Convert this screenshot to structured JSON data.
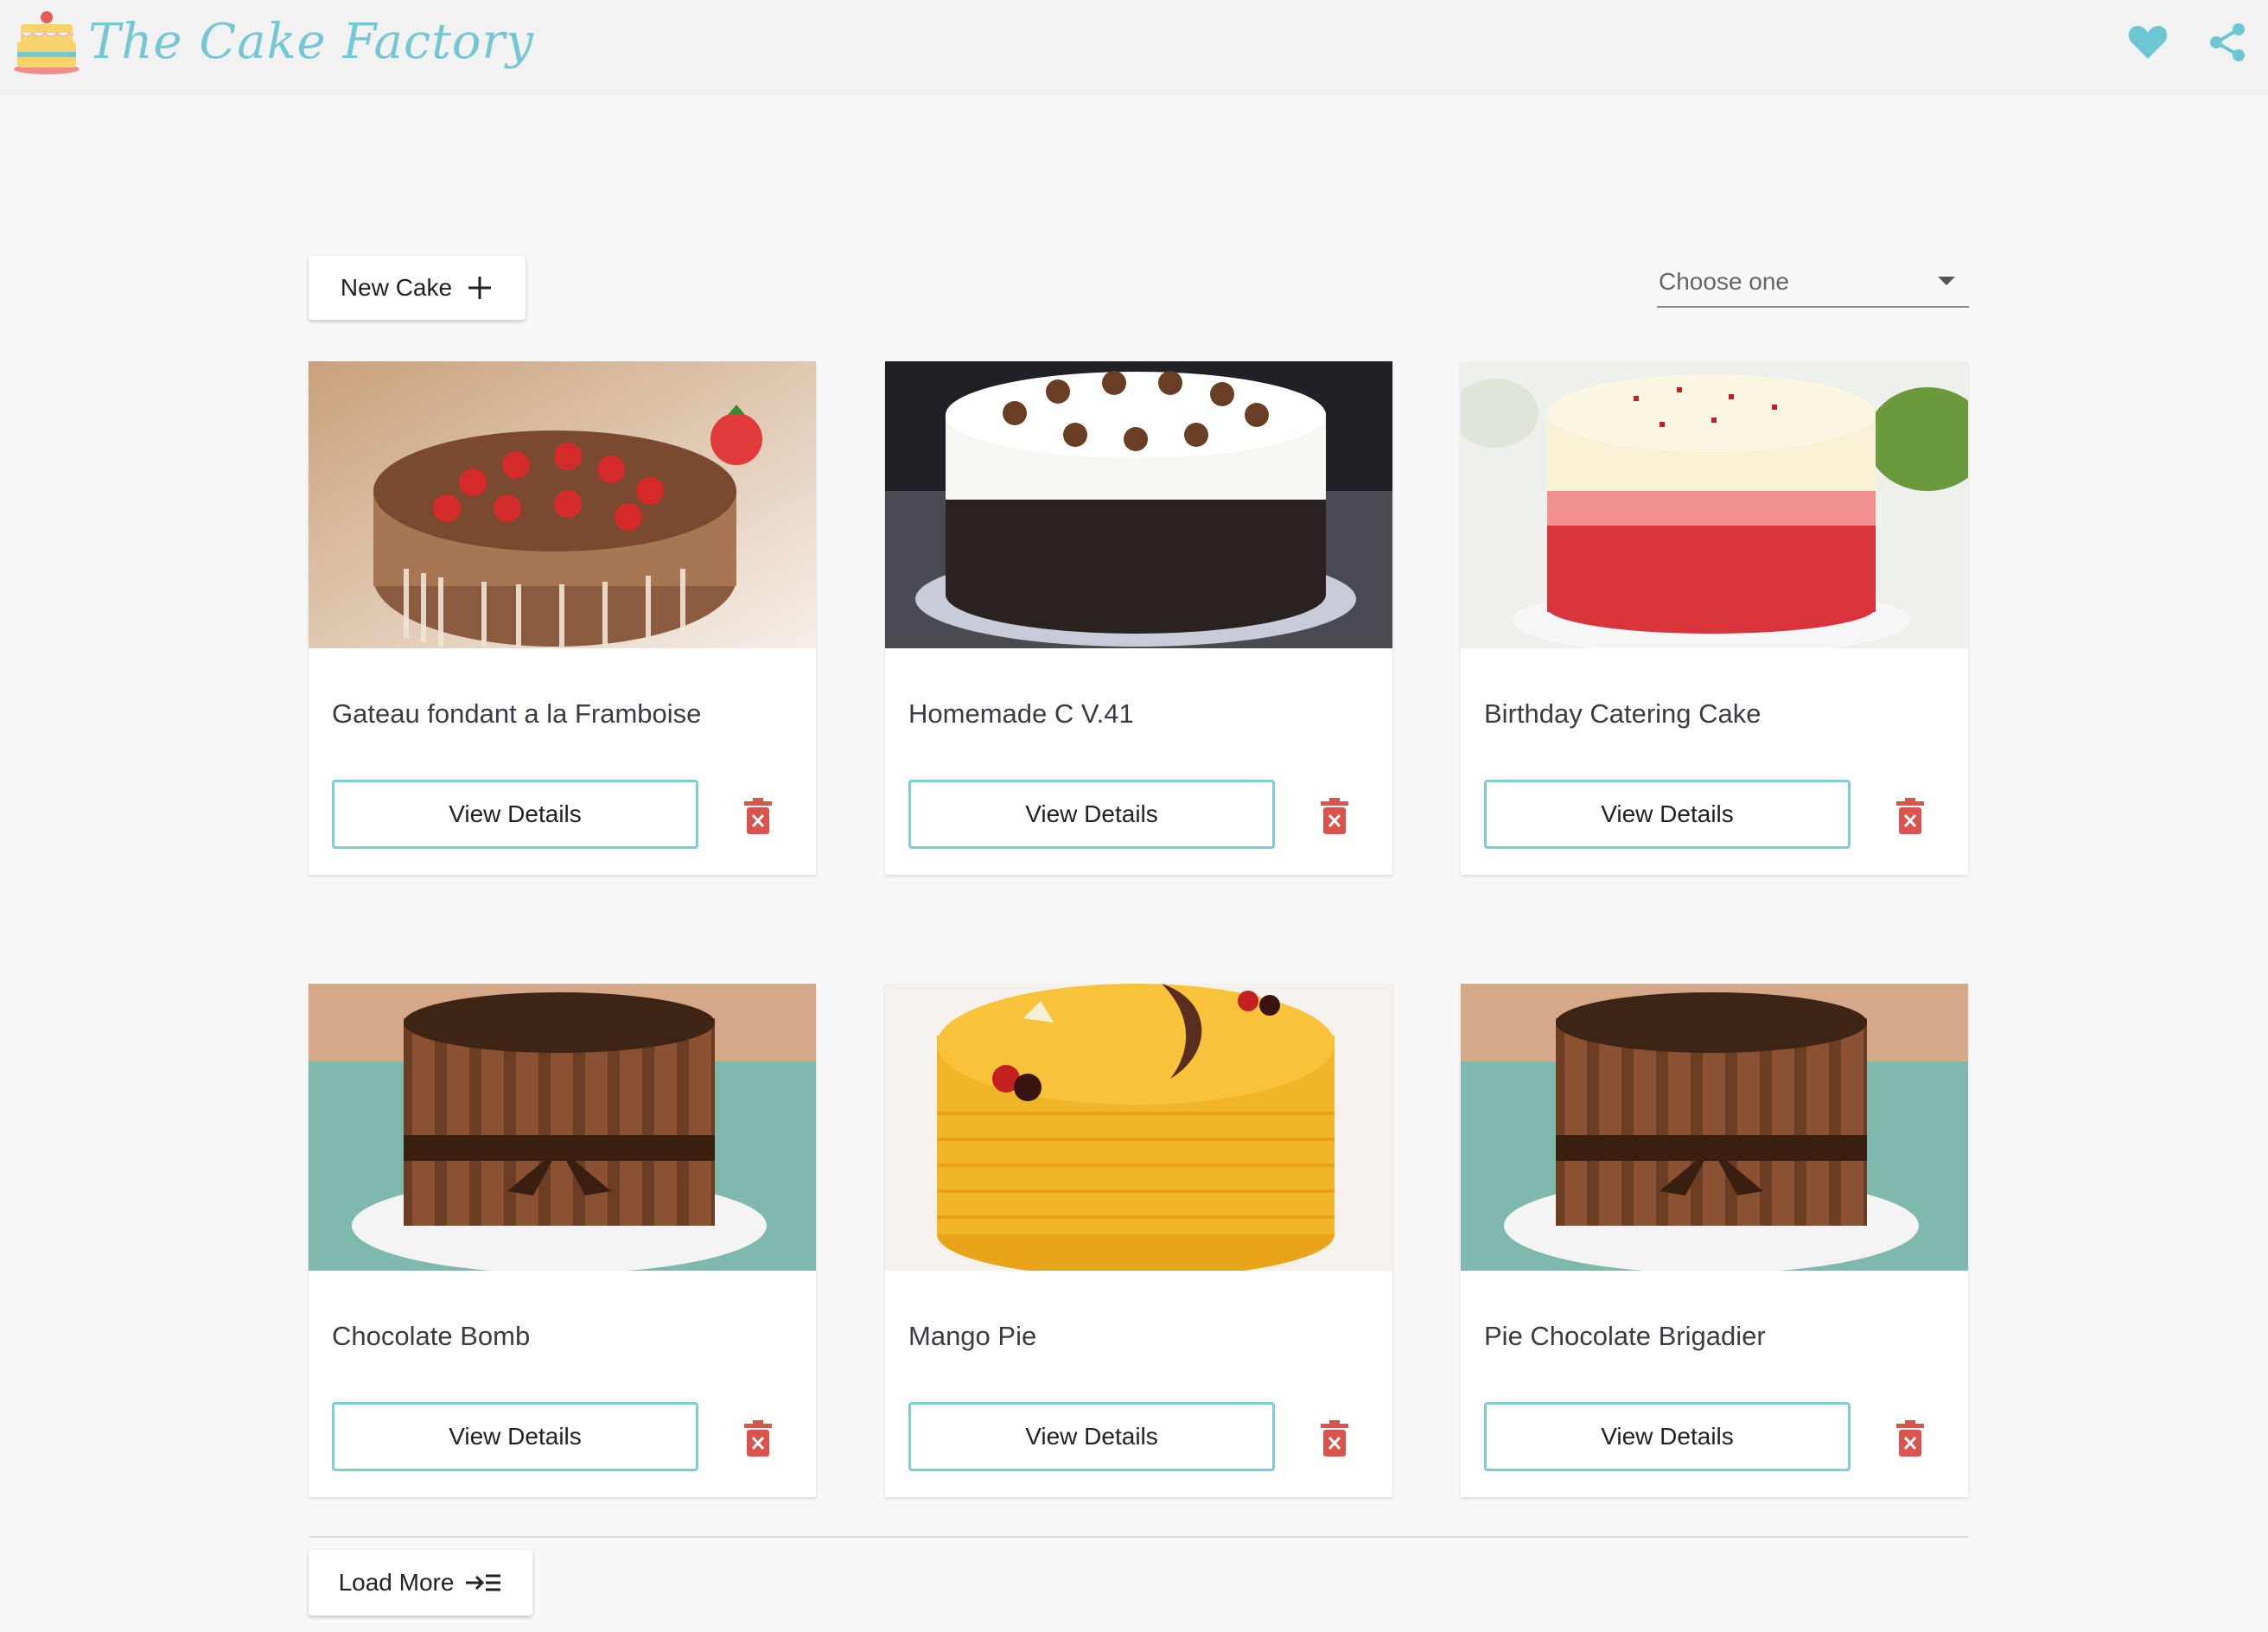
{
  "header": {
    "brand": "The Cake Factory",
    "accent_color": "#74c8d4",
    "icons": [
      "heart-icon",
      "share-icon"
    ]
  },
  "toolbar": {
    "new_cake_label": "New Cake",
    "filter_placeholder": "Choose one"
  },
  "cakes": [
    {
      "name": "Gateau fondant a la Framboise",
      "button": "View Details"
    },
    {
      "name": "Homemade C V.41",
      "button": "View Details"
    },
    {
      "name": "Birthday Catering Cake",
      "button": "View Details"
    },
    {
      "name": "Chocolate Bomb",
      "button": "View Details"
    },
    {
      "name": "Mango Pie",
      "button": "View Details"
    },
    {
      "name": "Pie Chocolate Brigadier",
      "button": "View Details"
    }
  ],
  "footer": {
    "load_more_label": "Load More"
  },
  "colors": {
    "delete": "#d9534f",
    "button_border": "#7ccdd8"
  }
}
